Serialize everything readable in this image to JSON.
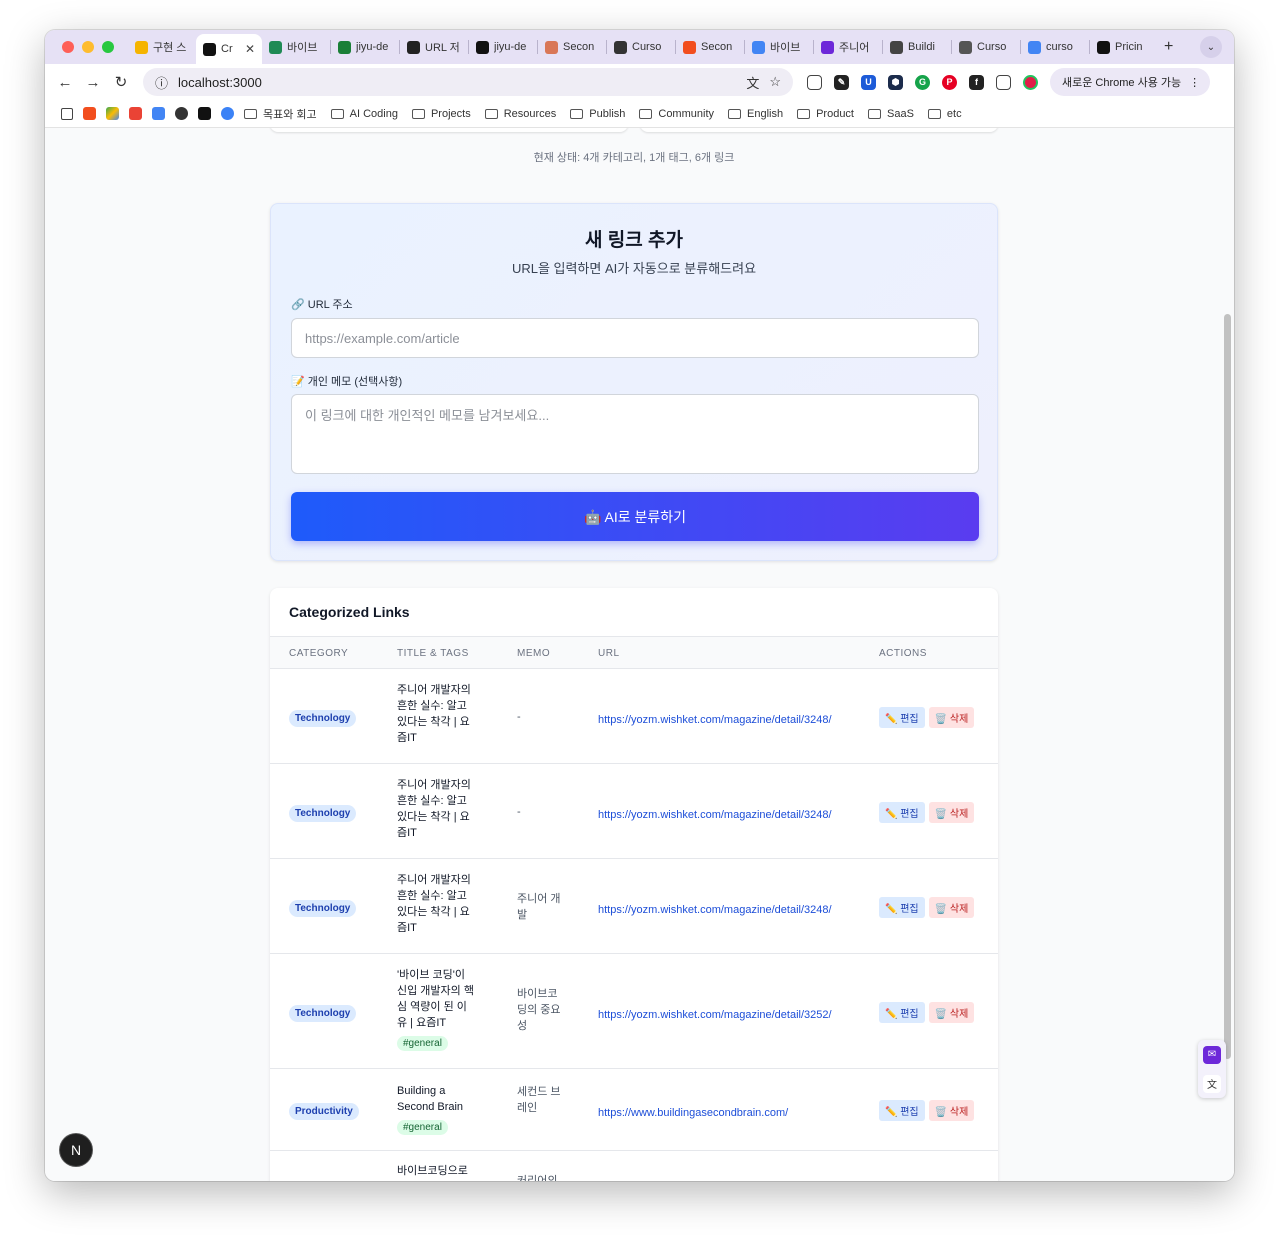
{
  "browser": {
    "tabs": [
      {
        "label": "구현 스",
        "favicon": "star-icon",
        "color": "#f5b400"
      },
      {
        "label": "Cr",
        "favicon": "app-icon",
        "color": "#111111",
        "active": true
      },
      {
        "label": "바이브",
        "favicon": "app-icon",
        "color": "#1f8a55"
      },
      {
        "label": "jiyu-de",
        "favicon": "app-icon",
        "color": "#1a7f37"
      },
      {
        "label": "URL 저",
        "favicon": "app-icon",
        "color": "#222222"
      },
      {
        "label": "jiyu-de",
        "favicon": "github-icon",
        "color": "#111111"
      },
      {
        "label": "Secon",
        "favicon": "app-icon",
        "color": "#d97757"
      },
      {
        "label": "Curso",
        "favicon": "openai-icon",
        "color": "#333333"
      },
      {
        "label": "Secon",
        "favicon": "figma-icon",
        "color": "#f24e1e"
      },
      {
        "label": "바이브",
        "favicon": "google-icon",
        "color": "#4285f4"
      },
      {
        "label": "주니어",
        "favicon": "app-icon",
        "color": "#6d28d9"
      },
      {
        "label": "Buildi",
        "favicon": "app-icon",
        "color": "#444444"
      },
      {
        "label": "Curso",
        "favicon": "app-icon",
        "color": "#555555"
      },
      {
        "label": "curso",
        "favicon": "google-icon",
        "color": "#4285f4"
      },
      {
        "label": "Pricin",
        "favicon": "app-icon",
        "color": "#111111"
      }
    ],
    "address": "localhost:3000",
    "chrome_update": "새로운 Chrome 사용 가능",
    "bookmarks": [
      {
        "label": "목표와 회고",
        "type": "folder"
      },
      {
        "label": "AI Coding",
        "type": "folder"
      },
      {
        "label": "Projects",
        "type": "folder"
      },
      {
        "label": "Resources",
        "type": "folder"
      },
      {
        "label": "Publish",
        "type": "folder"
      },
      {
        "label": "Community",
        "type": "folder"
      },
      {
        "label": "English",
        "type": "folder"
      },
      {
        "label": "Product",
        "type": "folder"
      },
      {
        "label": "SaaS",
        "type": "folder"
      },
      {
        "label": "etc",
        "type": "folder"
      }
    ]
  },
  "page": {
    "status": "현재 상태: 4개 카테고리, 1개 태그, 6개 링크",
    "add_link": {
      "title": "새 링크 추가",
      "subtitle": "URL을 입력하면 AI가 자동으로 분류해드려요",
      "url_label": "🔗 URL 주소",
      "url_placeholder": "https://example.com/article",
      "memo_label": "📝 개인 메모 (선택사항)",
      "memo_placeholder": "이 링크에 대한 개인적인 메모를 남겨보세요...",
      "button_label": "🤖 AI로 분류하기"
    },
    "links": {
      "title": "Categorized Links",
      "headers": {
        "category": "CATEGORY",
        "title": "TITLE & TAGS",
        "memo": "MEMO",
        "url": "URL",
        "actions": "ACTIONS"
      },
      "edit_label": "✏️ 편집",
      "delete_label": "🗑️ 삭제",
      "rows": [
        {
          "category": "Technology",
          "title": "주니어 개발자의 흔한 실수: 알고 있다는 착각 | 요즘IT",
          "tags": [],
          "memo": "-",
          "url": "https://yozm.wishket.com/magazine/detail/3248/"
        },
        {
          "category": "Technology",
          "title": "주니어 개발자의 흔한 실수: 알고 있다는 착각 | 요즘IT",
          "tags": [],
          "memo": "-",
          "url": "https://yozm.wishket.com/magazine/detail/3248/"
        },
        {
          "category": "Technology",
          "title": "주니어 개발자의 흔한 실수: 알고 있다는 착각 | 요즘IT",
          "tags": [],
          "memo": "주니어 개발",
          "url": "https://yozm.wishket.com/magazine/detail/3248/"
        },
        {
          "category": "Technology",
          "title": "'바이브 코딩'이 신입 개발자의 핵심 역량이 된 이유 | 요즘IT",
          "tags": [
            "#general"
          ],
          "memo": "바이브코딩의 중요성",
          "url": "https://yozm.wishket.com/magazine/detail/3252/"
        },
        {
          "category": "Productivity",
          "title": "Building a Second Brain",
          "tags": [
            "#general"
          ],
          "memo": "세컨드 브레인",
          "url": "https://www.buildingasecondbrain.com/"
        },
        {
          "category": "",
          "title": "바이브코딩으로",
          "tags": [],
          "memo": "커리어의",
          "url": ""
        }
      ]
    }
  },
  "colors": {
    "accent_start": "#1e5bfa",
    "accent_end": "#5a3cf0",
    "link": "#1d4ed8",
    "badge_bg": "#dbeafe",
    "tag_bg": "#dcfce7"
  },
  "overlay": {
    "next_badge": "N"
  }
}
